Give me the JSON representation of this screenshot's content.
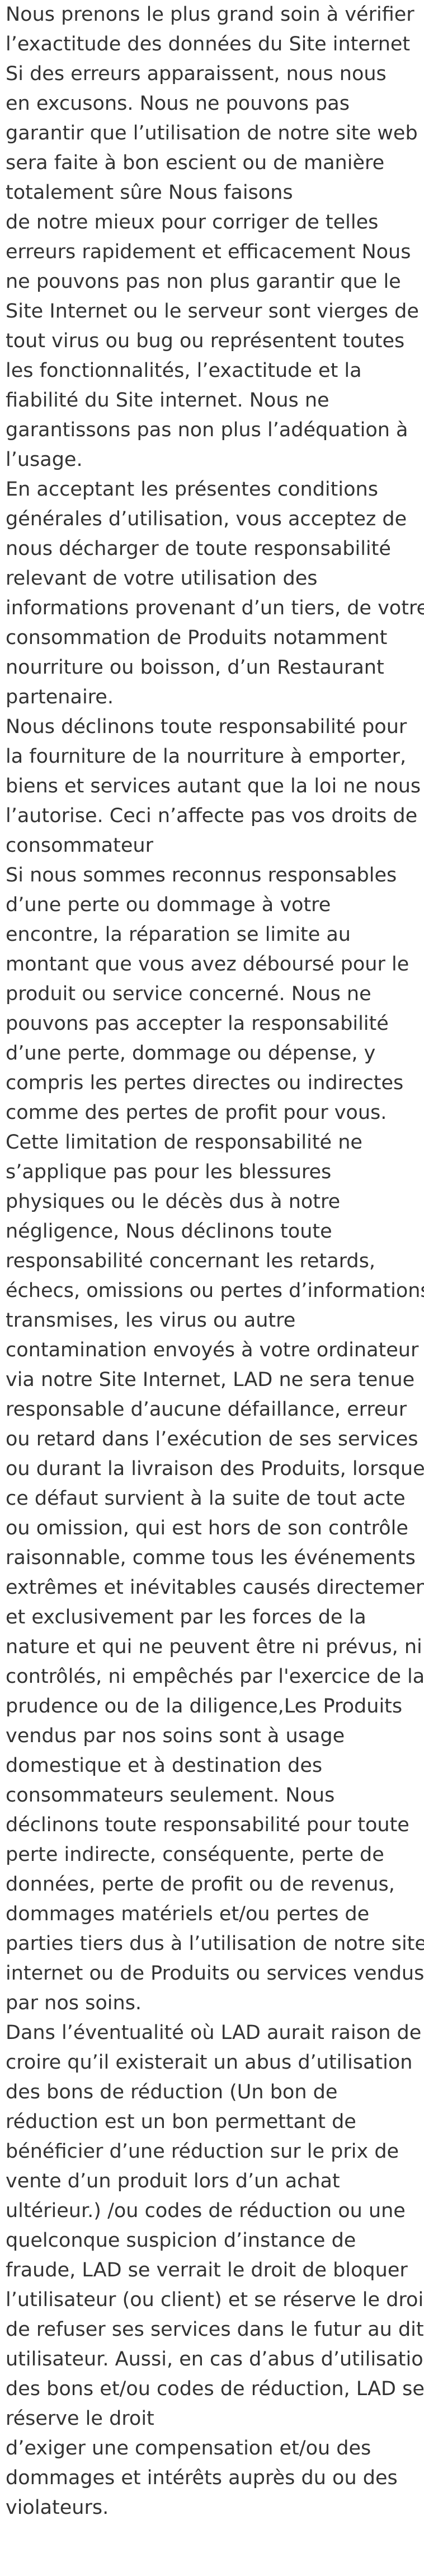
{
  "document": {
    "lines": [
      " Nous prenons le plus grand soin à vérifier",
      "l’exactitude des données du Site internet",
      "Si des erreurs apparaissent, nous nous",
      "en excusons. Nous ne pouvons pas",
      "garantir que l’utilisation de notre site web",
      "sera faite à bon escient ou de manière",
      "totalement sûre Nous faisons",
      "de notre mieux pour corriger de telles",
      "erreurs rapidement et efficacement Nous",
      "ne pouvons pas non plus garantir que le",
      "Site Internet ou le serveur sont vierges de",
      "tout virus ou bug ou représentent toutes",
      "les fonctionnalités, l’exactitude et la",
      "fiabilité du Site internet. Nous ne",
      "garantissons pas non plus l’adéquation à",
      "l’usage.",
      "En acceptant les présentes conditions",
      "générales d’utilisation, vous acceptez de",
      "nous décharger de toute responsabilité",
      "relevant de votre utilisation des",
      "informations provenant d’un tiers, de votre",
      "consommation de Produits notamment",
      "nourriture ou boisson, d’un Restaurant",
      "partenaire.",
      "Nous déclinons toute responsabilité pour",
      "la fourniture de la nourriture à emporter,",
      "biens et services autant que la loi ne nous",
      "l’autorise. Ceci n’affecte pas vos droits de",
      "consommateur",
      "Si nous sommes reconnus responsables",
      "d’une perte ou dommage à votre",
      "encontre, la réparation se limite au",
      "montant que vous avez déboursé pour le",
      "produit ou service concerné. Nous ne",
      "pouvons pas accepter la responsabilité",
      "d’une perte, dommage ou dépense, y",
      "compris les pertes directes ou indirectes",
      "comme des pertes de profit pour vous.",
      "Cette limitation de responsabilité ne",
      "s’applique pas pour les blessures",
      "physiques ou le décès dus à notre",
      "négligence, Nous déclinons toute",
      "responsabilité concernant les retards,",
      "échecs, omissions ou pertes d’informations",
      "transmises, les virus ou autre",
      "contamination envoyés à votre ordinateur",
      "via notre Site Internet, LAD ne sera tenue",
      "responsable d’aucune défaillance, erreur",
      "ou retard dans l’exécution de ses services",
      "ou durant la livraison des Produits, lorsque",
      "ce défaut survient à la suite de tout acte",
      "ou omission, qui est hors de son contrôle",
      "raisonnable, comme tous les événements",
      "extrêmes et inévitables causés directement",
      "et exclusivement par les forces de la",
      "nature et qui ne peuvent être ni prévus, ni",
      "contrôlés, ni empêchés par l'exercice de la",
      "prudence ou de la diligence,Les Produits",
      "vendus par nos soins sont à usage",
      "domestique et à destination des",
      "consommateurs seulement. Nous",
      "déclinons toute responsabilité pour toute",
      "perte indirecte, conséquente, perte de",
      "données, perte de profit ou de revenus,",
      "dommages matériels et/ou pertes de",
      "parties tiers dus à l’utilisation de notre site",
      "internet ou de Produits ou services vendus",
      "par nos soins.",
      "Dans l’éventualité où LAD aurait raison de",
      "croire qu’il existerait un abus d’utilisation",
      "des bons de réduction (Un bon de",
      "réduction est un bon permettant de",
      "bénéficier d’une réduction sur le prix de",
      "vente d’un produit lors d’un achat",
      "ultérieur.) /ou codes de réduction ou une",
      "quelconque suspicion d’instance de",
      "fraude, LAD se verrait le droit de bloquer",
      "l’utilisateur (ou client) et se réserve le droit",
      "de refuser ses services dans le futur au dit",
      "utilisateur. Aussi, en cas d’abus d’utilisation",
      "des bons et/ou codes de réduction, LAD se",
      "réserve le droit",
      "d’exiger une compensation et/ou des",
      "dommages et intérêts auprès du ou des",
      "violateurs."
    ]
  }
}
